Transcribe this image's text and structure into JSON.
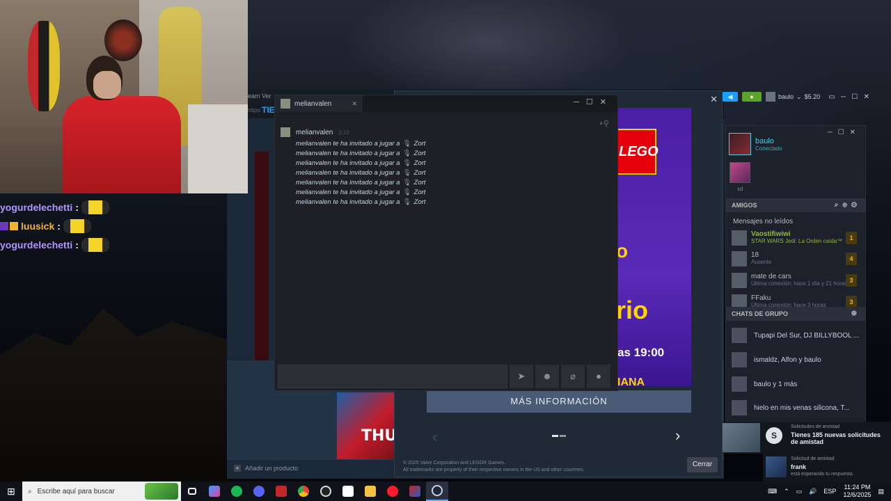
{
  "store": {
    "menu_label": "eam   Ver",
    "nav_title": "TIE",
    "url": "https:",
    "add_product": "Añadir un producto",
    "game_thumb_text": "THU"
  },
  "dialog": {
    "banner": {
      "logo": "LEGO",
      "line1": "o",
      "line2": "rio",
      "line3": "as 19:00",
      "line4": "IANA"
    },
    "more_info": "MÁS INFORMACIÓN",
    "copyright_line1": "© 2025 Valve Corporation and LEGO® Games.",
    "copyright_line2": "All trademarks are property of their respective owners in the US and other countries.",
    "close_button": "Cerrar"
  },
  "steam_top": {
    "username": "baulo",
    "balance": "$5.20"
  },
  "friends": {
    "me": {
      "name": "baulo",
      "status": "Conectado"
    },
    "favorite_label": "xd",
    "friends_header": "AMIGOS",
    "unread_label": "Mensajes no leídos",
    "unread": [
      {
        "name": "Vaostifiwiwi",
        "status": "STAR WARS Jedi: La Orden caída™",
        "count": "1",
        "ingame": true
      },
      {
        "name": "18",
        "status": "Ausente",
        "count": "4",
        "ingame": false
      },
      {
        "name": "mate de cars",
        "status": "Última conexión: hace 1 día y 21 horas",
        "count": "3",
        "ingame": false
      },
      {
        "name": "FFaku",
        "status": "Última conexión: hace 3 horas",
        "count": "3",
        "ingame": false
      }
    ],
    "group_header": "CHATS DE GRUPO",
    "groups": [
      {
        "name": "Tupapi Del Sur, DJ BILLYBOOL ..."
      },
      {
        "name": "ismaldz, Alfon y baulo"
      },
      {
        "name": "baulo y 1 más"
      },
      {
        "name": "hielo en mis venas silicona, T..."
      }
    ]
  },
  "chat": {
    "tab_name": "melianvalen",
    "sender": "melianvalen",
    "time": "3:16",
    "messages": [
      {
        "text": "melianvalen te ha invitado a jugar a",
        "game": "Zort"
      },
      {
        "text": "melianvalen te ha invitado a jugar a",
        "game": "Zort"
      },
      {
        "text": "melianvalen te ha invitado a jugar a",
        "game": "Zort"
      },
      {
        "text": "melianvalen te ha invitado a jugar a",
        "game": "Zort"
      },
      {
        "text": "melianvalen te ha invitado a jugar a",
        "game": "Zort"
      },
      {
        "text": "melianvalen te ha invitado a jugar a",
        "game": "Zort"
      },
      {
        "text": "melianvalen te ha invitado a jugar a",
        "game": "Zort"
      }
    ]
  },
  "stream_chat": [
    {
      "user": "yogurdelechetti",
      "color": "#b197fc"
    },
    {
      "user": "luusick",
      "color": "#f1b530"
    },
    {
      "user": "yogurdelechetti",
      "color": "#b197fc"
    }
  ],
  "notifications": {
    "friend_requests_title": "Solicitudes de amistad",
    "friend_requests_body": "Tienes 185 nuevas solicitudes de amistad",
    "friend_request_title": "Solicitud de amistad",
    "friend_request_name": "frank",
    "friend_request_sub": "está esperando tu respuesta"
  },
  "taskbar": {
    "search_placeholder": "Escribe aquí para buscar",
    "lang": "ESP",
    "time": "11:24 PM",
    "date": "12/6/2025"
  }
}
